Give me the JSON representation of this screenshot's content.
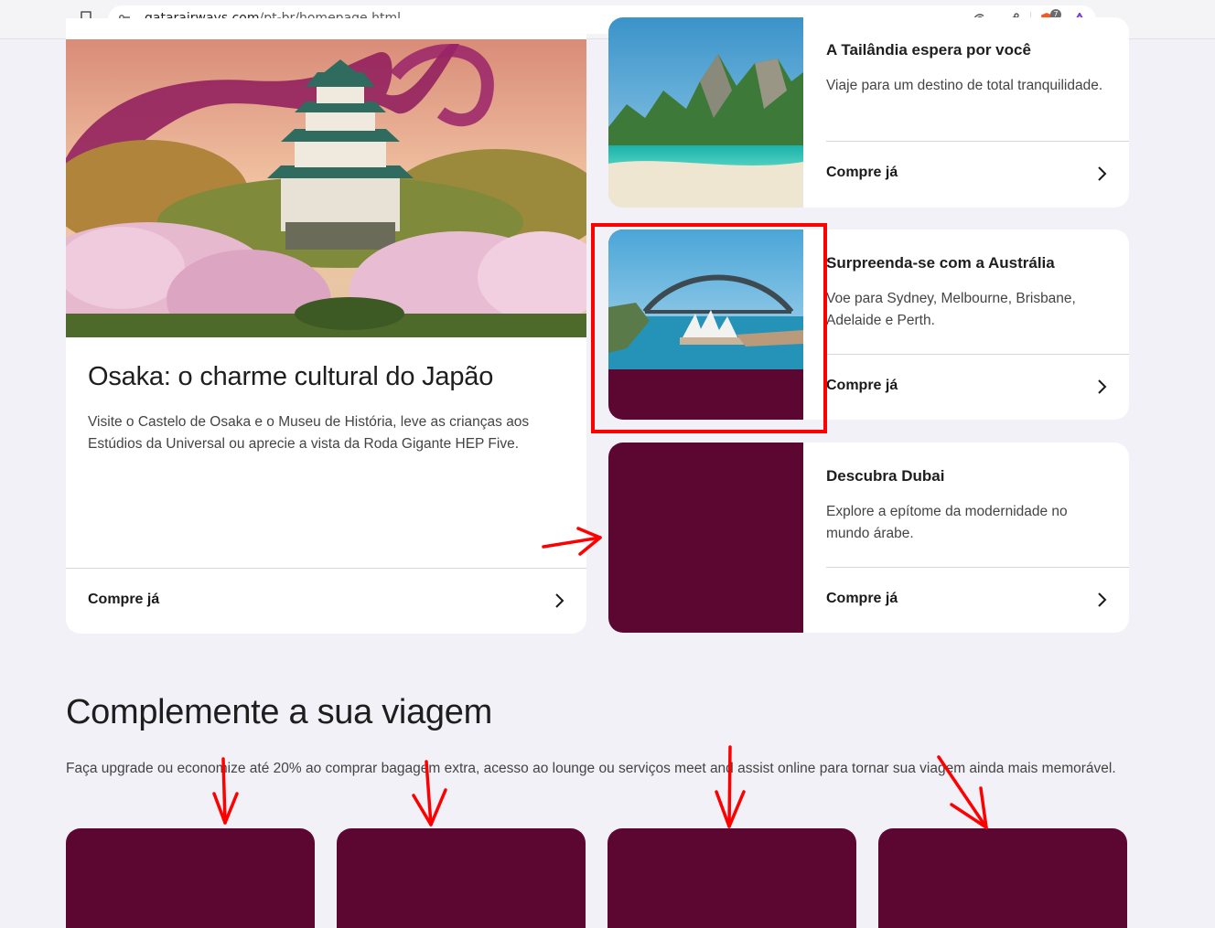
{
  "browser": {
    "url_host": "qatarairways.com",
    "url_path": "/pt-br/homepage.html",
    "brave_badge": "7"
  },
  "featured": {
    "title": "Osaka: o charme cultural do Japão",
    "description": "Visite o Castelo de Osaka e o Museu de História, leve as crianças aos Estúdios da Universal ou aprecie a vista da Roda Gigante HEP Five.",
    "cta": "Compre já"
  },
  "destinations": [
    {
      "title": "A Tailândia espera por você",
      "description": "Viaje para um destino de total tranquilidade.",
      "cta": "Compre já"
    },
    {
      "title": "Surpreenda-se com a Austrália",
      "description": "Voe para Sydney, Melbourne, Brisbane, Adelaide e Perth.",
      "cta": "Compre já"
    },
    {
      "title": "Descubra Dubai",
      "description": "Explore a epítome da modernidade no mundo árabe.",
      "cta": "Compre já"
    }
  ],
  "complement": {
    "title": "Complemente a sua viagem",
    "description": "Faça upgrade ou economize até 20% ao comprar bagagem extra, acesso ao lounge ou serviços meet and assist online para tornar sua viagem ainda mais memorável."
  },
  "colors": {
    "placeholder": "#5c0632",
    "annotation": "#ff0000",
    "background": "#f1f1f7"
  }
}
